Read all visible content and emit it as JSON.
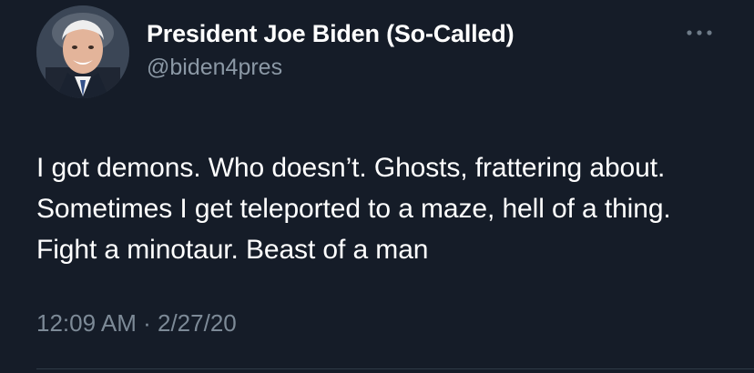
{
  "tweet": {
    "author": {
      "display_name": "President Joe Biden (So-Called)",
      "handle": "@biden4pres"
    },
    "text": "I got demons. Who doesn’t. Ghosts, frattering about. Sometimes I get teleported to a maze, hell of a thing. Fight a minotaur. Beast of a man",
    "time": "12:09 AM",
    "separator": "·",
    "date": "2/27/20"
  },
  "icons": {
    "more": "more-horizontal-icon",
    "avatar": "profile-photo"
  },
  "colors": {
    "background": "#151c28",
    "text": "#ffffff",
    "secondary": "#8b98a5"
  }
}
